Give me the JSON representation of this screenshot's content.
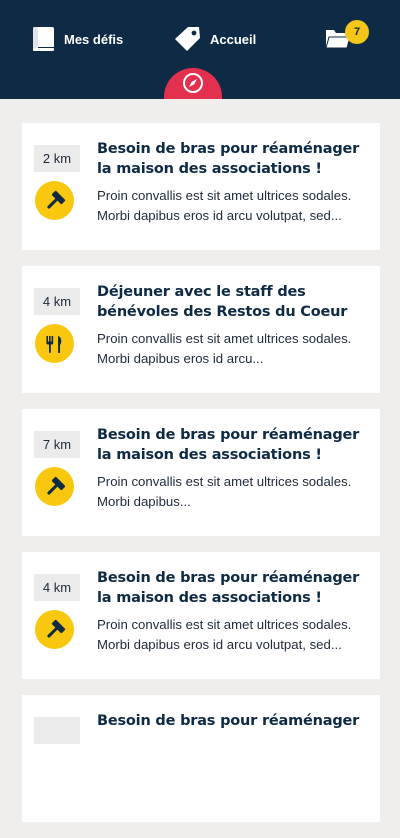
{
  "header": {
    "nav_defis": {
      "label": "Mes défis",
      "icon": "book-icon"
    },
    "nav_accueil": {
      "label": "Accueil",
      "icon": "tag-icon"
    },
    "folder": {
      "icon": "folder-icon",
      "badge_count": "7"
    },
    "compass": {
      "icon": "compass-icon"
    }
  },
  "colors": {
    "header_bg": "#0f2a45",
    "accent_red": "#e4304f",
    "accent_yellow": "#f9c80e",
    "card_bg": "#ffffff",
    "page_bg": "#efeeec"
  },
  "challenges": [
    {
      "distance": "2 km",
      "icon": "hammer-icon",
      "title": "Besoin de bras pour réaménager la maison des associations !",
      "description": "Proin convallis est sit amet ultrices sodales. Morbi dapibus eros id arcu volutpat, sed..."
    },
    {
      "distance": "4 km",
      "icon": "fork-knife-icon",
      "title": "Déjeuner avec le staff des bénévoles des Restos du Coeur",
      "description": "Proin convallis est sit amet ultrices sodales. Morbi dapibus eros id arcu..."
    },
    {
      "distance": "7 km",
      "icon": "hammer-icon",
      "title": "Besoin de bras pour réaménager la maison des associations !",
      "description": "Proin convallis est sit amet ultrices sodales. Morbi dapibus..."
    },
    {
      "distance": "4 km",
      "icon": "hammer-icon",
      "title": "Besoin de bras pour réaménager la maison des associations !",
      "description": "Proin convallis est sit amet ultrices sodales. Morbi dapibus eros id arcu volutpat, sed..."
    },
    {
      "distance": "",
      "icon": "hammer-icon",
      "title": "Besoin de bras pour réaménager",
      "description": ""
    }
  ]
}
